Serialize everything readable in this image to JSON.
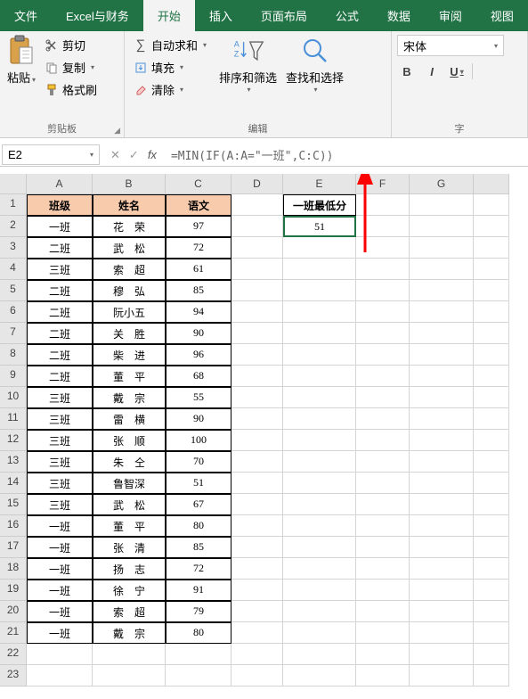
{
  "tabs": {
    "file": "文件",
    "custom": "Excel与财务",
    "home": "开始",
    "insert": "插入",
    "layout": "页面布局",
    "formula": "公式",
    "data": "数据",
    "review": "审阅",
    "view": "视图"
  },
  "ribbon": {
    "paste": "粘贴",
    "cut": "剪切",
    "copy": "复制",
    "formatPainter": "格式刷",
    "clipboard": "剪贴板",
    "autosum": "自动求和",
    "fill": "填充",
    "clear": "清除",
    "sortFilter": "排序和筛选",
    "findSelect": "查找和选择",
    "edit": "编辑",
    "fontName": "宋体",
    "fontGroup": "字",
    "bold": "B",
    "italic": "I",
    "underline": "U"
  },
  "nameBox": "E2",
  "formula": "=MIN(IF(A:A=\"一班\",C:C))",
  "cols": [
    "A",
    "B",
    "C",
    "D",
    "E",
    "F",
    "G"
  ],
  "headers": {
    "a": "班级",
    "b": "姓名",
    "c": "语文",
    "e": "一班最低分"
  },
  "e2": "51",
  "rows": [
    {
      "a": "一班",
      "b": "花　荣",
      "c": "97"
    },
    {
      "a": "二班",
      "b": "武　松",
      "c": "72"
    },
    {
      "a": "三班",
      "b": "索　超",
      "c": "61"
    },
    {
      "a": "二班",
      "b": "穆　弘",
      "c": "85"
    },
    {
      "a": "二班",
      "b": "阮小五",
      "c": "94"
    },
    {
      "a": "二班",
      "b": "关　胜",
      "c": "90"
    },
    {
      "a": "二班",
      "b": "柴　进",
      "c": "96"
    },
    {
      "a": "二班",
      "b": "董　平",
      "c": "68"
    },
    {
      "a": "三班",
      "b": "戴　宗",
      "c": "55"
    },
    {
      "a": "三班",
      "b": "雷　横",
      "c": "90"
    },
    {
      "a": "三班",
      "b": "张　顺",
      "c": "100"
    },
    {
      "a": "三班",
      "b": "朱　仝",
      "c": "70"
    },
    {
      "a": "三班",
      "b": "鲁智深",
      "c": "51"
    },
    {
      "a": "三班",
      "b": "武　松",
      "c": "67"
    },
    {
      "a": "一班",
      "b": "董　平",
      "c": "80"
    },
    {
      "a": "一班",
      "b": "张　清",
      "c": "85"
    },
    {
      "a": "一班",
      "b": "扬　志",
      "c": "72"
    },
    {
      "a": "一班",
      "b": "徐　宁",
      "c": "91"
    },
    {
      "a": "一班",
      "b": "索　超",
      "c": "79"
    },
    {
      "a": "一班",
      "b": "戴　宗",
      "c": "80"
    }
  ]
}
